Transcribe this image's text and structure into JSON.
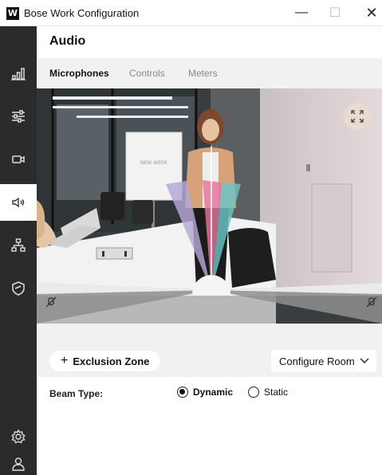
{
  "window": {
    "logo": "W",
    "title": "Bose Work Configuration",
    "minimize": "—",
    "maximize": "☐",
    "close": "✕"
  },
  "sidebar": {
    "items": [
      {
        "icon": "signal-bars-icon",
        "active": false
      },
      {
        "icon": "sliders-icon",
        "active": false
      },
      {
        "icon": "camera-icon",
        "active": false
      },
      {
        "icon": "speaker-icon",
        "active": true
      },
      {
        "icon": "network-icon",
        "active": false
      },
      {
        "icon": "shield-icon",
        "active": false
      }
    ],
    "bottom": [
      {
        "icon": "settings-gear-icon"
      },
      {
        "icon": "user-icon"
      }
    ]
  },
  "page": {
    "title": "Audio",
    "tabs": [
      {
        "label": "Microphones",
        "active": true
      },
      {
        "label": "Controls",
        "active": false
      },
      {
        "label": "Meters",
        "active": false
      }
    ]
  },
  "camera": {
    "whiteboard_text": "NEW WEEK",
    "beam_colors": [
      "#b7a7d6",
      "#e9739b",
      "#6cc5c6"
    ],
    "exclusion_icons": [
      "mic-off-left-icon",
      "mic-off-right-icon"
    ]
  },
  "controls": {
    "exclusion_plus": "+",
    "exclusion_label": "Exclusion Zone",
    "configure_label": "Configure Room",
    "beam_type_label": "Beam Type:",
    "beam_options": [
      {
        "label": "Dynamic",
        "selected": true
      },
      {
        "label": "Static",
        "selected": false
      }
    ]
  }
}
